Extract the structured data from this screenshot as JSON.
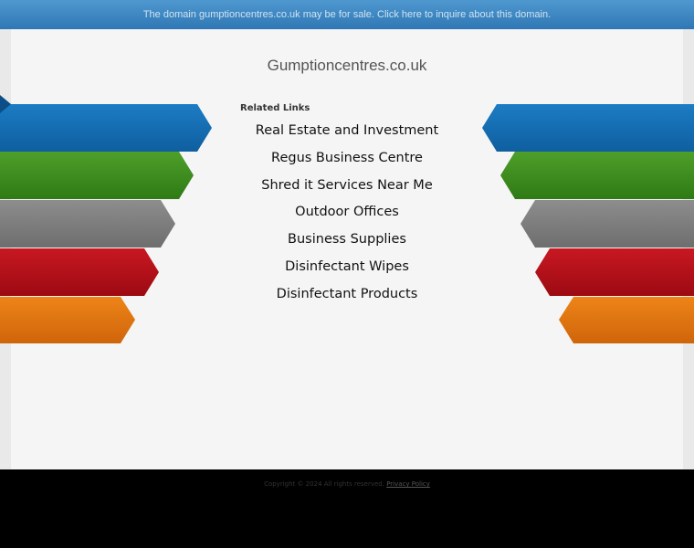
{
  "sale_banner": {
    "text": "The domain gumptioncentres.co.uk may be for sale. Click here to inquire about this domain."
  },
  "domain_title": "Gumptioncentres.co.uk",
  "related": {
    "heading": "Related Links",
    "links": [
      "Real Estate and Investment",
      "Regus Business Centre",
      "Shred it Services Near Me",
      "Outdoor Offices",
      "Business Supplies",
      "Disinfectant Wipes",
      "Disinfectant Products"
    ]
  },
  "footer": {
    "copyright": "Copyright © 2024 All rights reserved.",
    "privacy_link": "Privacy Policy"
  },
  "colors": {
    "blue": "#1a6fb5",
    "green": "#3f8f1f",
    "gray": "#7f7f7f",
    "red": "#b5101a",
    "orange": "#e07411"
  }
}
